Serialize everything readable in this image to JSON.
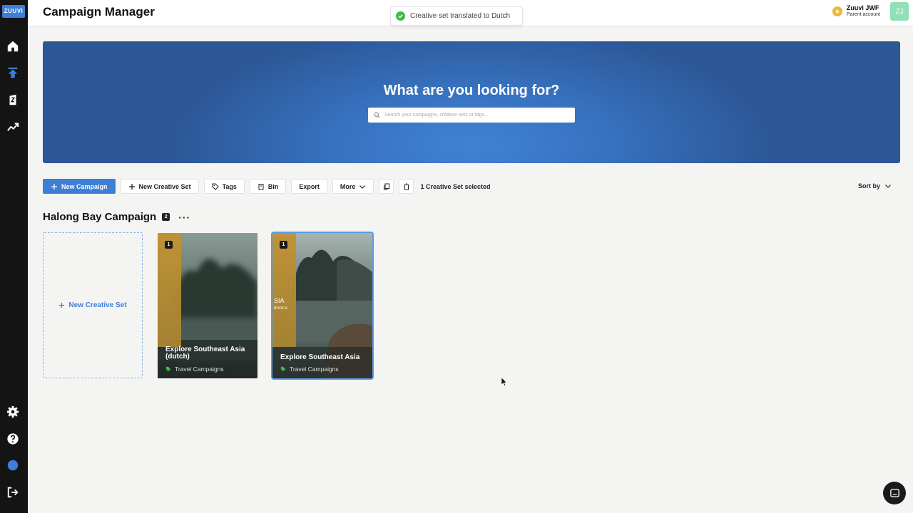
{
  "app": {
    "logo_text": "ZUUVI",
    "page_title": "Campaign Manager"
  },
  "toast": {
    "message": "Creative set translated to Dutch"
  },
  "account": {
    "name": "Zuuvi JWF",
    "subtitle": "Parent account",
    "avatar_initials": "ZJ",
    "avatar_color": "#8fe0b4"
  },
  "sidebar": {
    "items": [
      {
        "name": "home",
        "icon": "home-icon"
      },
      {
        "name": "upload",
        "icon": "upload-icon"
      },
      {
        "name": "creative",
        "icon": "creative-icon"
      },
      {
        "name": "analytics",
        "icon": "analytics-icon"
      }
    ],
    "bottom_items": [
      {
        "name": "settings",
        "icon": "gear-icon"
      },
      {
        "name": "help",
        "icon": "help-icon"
      },
      {
        "name": "status",
        "icon": "status-dot-icon"
      },
      {
        "name": "logout",
        "icon": "logout-icon"
      }
    ]
  },
  "hero": {
    "title": "What are you looking for?",
    "search_placeholder": "Search your campaigns, creative sets or tags..."
  },
  "toolbar": {
    "new_campaign": "New Campaign",
    "new_creative_set": "New Creative Set",
    "tags": "Tags",
    "bin": "Bin",
    "export": "Export",
    "more": "More",
    "selected_text": "1 Creative Set selected",
    "sort_by": "Sort by"
  },
  "campaign": {
    "title": "Halong Bay Campaign",
    "count": "2",
    "new_set_label": "New Creative Set",
    "creative_sets": [
      {
        "title": "Explore Southeast Asia (dutch)",
        "badge": "1",
        "tag": "Travel Campaigns",
        "selected": false
      },
      {
        "title": "Explore Southeast Asia",
        "badge": "1",
        "tag": "Travel Campaigns",
        "selected": true,
        "band_text": "SIA",
        "band_subtext": "BOOK A"
      }
    ]
  },
  "colors": {
    "accent": "#3d7fd6",
    "sidebar_bg": "#141414",
    "success": "#3fb950"
  }
}
